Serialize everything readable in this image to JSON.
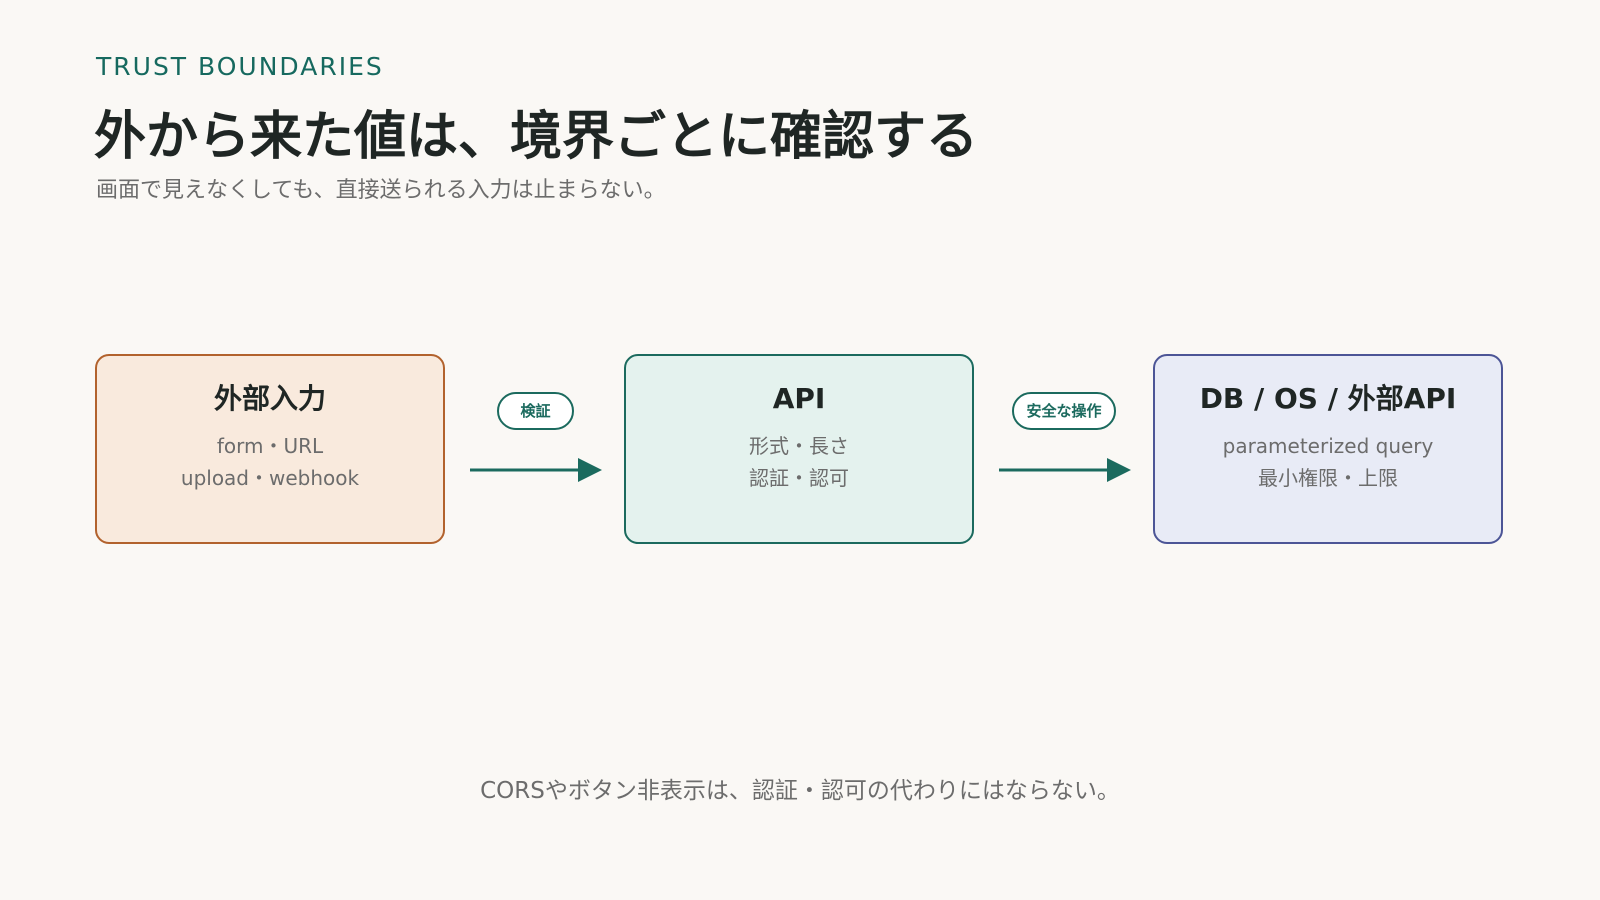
{
  "header": {
    "eyebrow": "TRUST BOUNDARIES",
    "title": "外から来た値は、境界ごとに確認する",
    "subtitle": "画面で見えなくしても、直接送られる入力は止まらない。"
  },
  "nodes": [
    {
      "title": "外部入力",
      "lines": [
        "form・URL",
        "upload・webhook"
      ]
    },
    {
      "title": "API",
      "lines": [
        "形式・長さ",
        "認証・認可"
      ]
    },
    {
      "title": "DB / OS / 外部API",
      "lines": [
        "parameterized query",
        "最小権限・上限"
      ]
    }
  ],
  "edges": [
    {
      "label": "検証"
    },
    {
      "label": "安全な操作"
    }
  ],
  "footer": "CORSやボタン非表示は、認証・認可の代わりにはならない。",
  "colors": {
    "accent": "#16695f",
    "input_fill": "#f9eadd",
    "input_border": "#b2622d",
    "api_fill": "#e4f2ee",
    "api_border": "#1b6a5e",
    "db_fill": "#e8ebf6",
    "db_border": "#4c5596",
    "background": "#faf8f5"
  }
}
